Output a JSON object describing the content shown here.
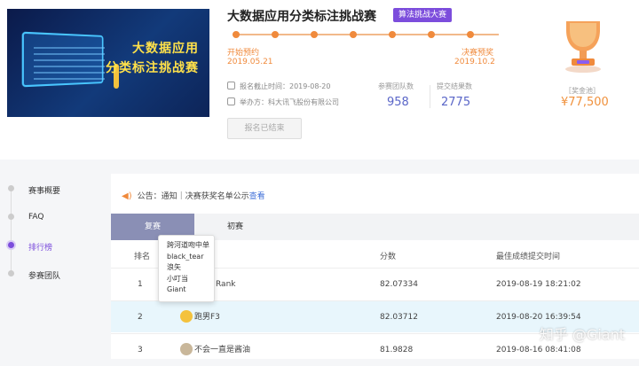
{
  "banner": {
    "line1": "大数据应用",
    "line2": "分类标注挑战赛"
  },
  "competition": {
    "title": "大数据应用分类标注挑战赛",
    "tag": "算法挑战大赛"
  },
  "timeline": {
    "start_label": "开始预约",
    "start_date": "2019.05.21",
    "end_label": "决赛预奖",
    "end_date": "2019.10.2",
    "dots": 7
  },
  "meta": {
    "deadline": "报名截止时间：2019-08-20",
    "organizer": "举办方：科大讯飞股份有限公司"
  },
  "stats": {
    "teams_label": "参赛团队数",
    "teams_value": "958",
    "submissions_label": "提交结果数",
    "submissions_value": "2775"
  },
  "signup_button": "报名已结束",
  "prize": {
    "label": "［奖金池］",
    "value": "¥77,500"
  },
  "sidebar": {
    "items": [
      {
        "label": "赛事概要",
        "active": false
      },
      {
        "label": "FAQ",
        "active": false
      },
      {
        "label": "排行榜",
        "active": true
      },
      {
        "label": "参赛团队",
        "active": false
      }
    ]
  },
  "notice": {
    "prefix": "公告：通知｜决赛获奖名单公示",
    "link": "查看"
  },
  "tabs": {
    "active": "复赛",
    "other": "初赛"
  },
  "table": {
    "headers": {
      "rank": "排名",
      "score": "分数",
      "time": "最佳成绩提交时间"
    },
    "rows": [
      {
        "rank": "1",
        "team": "Rank",
        "score": "82.07334",
        "time": "2019-08-19 18:21:02"
      },
      {
        "rank": "2",
        "team": "跑男F3",
        "score": "82.03712",
        "time": "2019-08-20 16:39:54"
      },
      {
        "rank": "3",
        "team": "不会一直是酱油",
        "score": "81.9828",
        "time": "2019-08-16 08:41:08"
      }
    ]
  },
  "tooltip": {
    "members": [
      "跨河道吻中单",
      "black_tear",
      "浪矢",
      "小叮当",
      "Giant"
    ]
  },
  "watermark": "知乎 @Giant",
  "colors": {
    "accent": "#7c4ddc",
    "orange": "#f08a3c",
    "stat_blue": "#5a66c8",
    "highlight_row": "#e8f6fc"
  }
}
